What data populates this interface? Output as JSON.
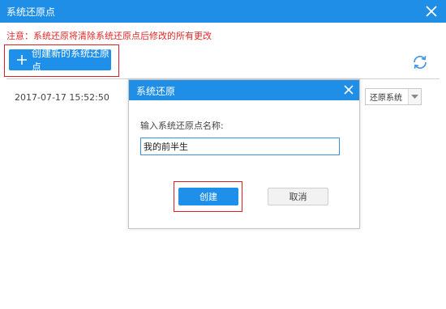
{
  "window": {
    "title": "系统还原点"
  },
  "notice": "注意：系统还原将清除系统还原点后修改的所有更改",
  "toolbar": {
    "create_label": "创建新的系统还原点"
  },
  "restore_points": [
    {
      "time": "2017-07-17 15:52:50",
      "action": "还原系统"
    }
  ],
  "dialog": {
    "title": "系统还原",
    "prompt": "输入系统还原点名称:",
    "input_value": "我的前半生",
    "ok_label": "创建",
    "cancel_label": "取消"
  },
  "colors": {
    "accent": "#1e8ee6",
    "highlight": "#e02020",
    "notice": "#e02828"
  },
  "icons": {
    "close": "close-icon",
    "plus": "plus-icon",
    "refresh": "refresh-icon",
    "dropdown": "chevron-down-icon"
  }
}
